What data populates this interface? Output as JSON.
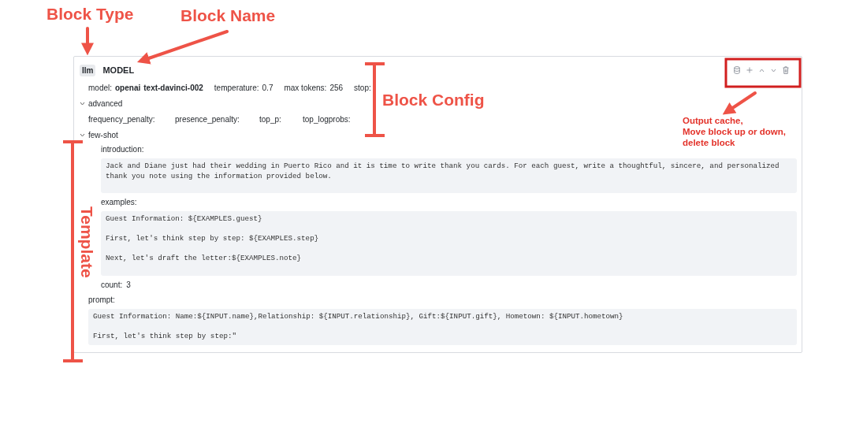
{
  "annotations": {
    "block_type_label": "Block Type",
    "block_name_label": "Block Name",
    "block_config_label": "Block Config",
    "template_label": "Template",
    "toolbar_note": [
      "Output cache,",
      "Move block up or down,",
      "delete block"
    ]
  },
  "block": {
    "type": "llm",
    "name": "MODEL",
    "config": [
      {
        "kind": "model",
        "label": "model:",
        "values": [
          "openai",
          "text-davinci-002"
        ]
      },
      {
        "kind": "number",
        "label": "temperature:",
        "values": [
          "0.7"
        ]
      },
      {
        "kind": "number",
        "label": "max tokens:",
        "values": [
          "256"
        ]
      },
      {
        "kind": "number",
        "label": "stop:"
      }
    ],
    "advanced": {
      "label": "advanced",
      "expanded": true,
      "params": [
        "frequency_penalty:",
        "presence_penalty:",
        "top_p:",
        "top_logprobs:"
      ]
    },
    "few_shot": {
      "label": "few-shot",
      "expanded": true,
      "introduction": {
        "label": "introduction:",
        "text": "Jack and Diane just had their wedding in Puerto Rico and it is time to write thank you cards. For each guest, write a thoughtful, sincere, and personalized thank you note using the information provided below."
      },
      "examples": {
        "label": "examples:",
        "text": "Guest Information: ${EXAMPLES.guest}\n\nFirst, let's think step by step: ${EXAMPLES.step}\n\nNext, let's draft the letter:${EXAMPLES.note}"
      },
      "count": {
        "label": "count:",
        "value": "3"
      }
    },
    "prompt": {
      "label": "prompt:",
      "text": "Guest Information: Name:${INPUT.name},Relationship: ${INPUT.relationship}, Gift:${INPUT.gift}, Hometown: ${INPUT.hometown}\n\nFirst, let's think step by step:\""
    }
  }
}
